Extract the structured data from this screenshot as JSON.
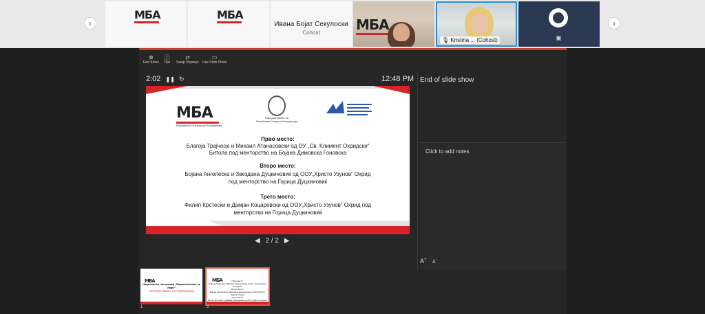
{
  "strip": {
    "tiles": [
      {
        "logo": "МБА"
      },
      {
        "logo": "МБА"
      },
      {
        "name": "Ивана Бојат Секулоски",
        "role": "Cohost"
      },
      {
        "logo": "МБА"
      },
      {
        "name": "Kristina ...",
        "role": "(Cohost)"
      },
      {
        "icon": "obs-logo-icon"
      }
    ]
  },
  "toolbar": {
    "end_show": "End Show",
    "tips": "Tips",
    "swap_displays": "Swap Displays",
    "use_slide_show": "Use Slide Show"
  },
  "presenter": {
    "timer": "2:02",
    "clock": "12:48 PM",
    "pager": "2 / 2",
    "end_of_show": "End of slide show",
    "notes_placeholder": "Click to add notes",
    "font_up": "A",
    "font_down": "A"
  },
  "slide": {
    "logo_text": "МБА",
    "logo_caption": "Македонска Банкарска Асоцијација",
    "bank_caption_1": "Народна Банка на",
    "bank_caption_2": "Република Северна Македонија",
    "first_head": "Прво место:",
    "first_1": "Благоја Трајческi и Михаил Атанасовски од ОУ „Св. Климент Охридски“",
    "first_2": "Битола под менторство на Бојана Димовска Гоновска",
    "second_head": "Второ место:",
    "second_1": "Бојана Ангелеска и Звездана Дуцкиновиќ од ООУ„Христо Узунов“ Охрид",
    "second_2": "под менторство на Горица Дуцкиновиќ",
    "third_head": "Трето место:",
    "third_1": "Филип Крстески и Дамјан Коцаревски од ООУ„Христо Узунов“ Охрид под",
    "third_2": "менторство на Горица Дуцкиновиќ"
  },
  "thumbs": [
    {
      "num": "1",
      "title": "Национален натпревар „Европска квиз на пари“",
      "sub": "ПРОГЛАСУВАЊЕ НА ПОБЕДНИЦИ"
    },
    {
      "num": "2"
    }
  ],
  "colors": {
    "accent": "#d8232a",
    "presenter_bar": "#c8402c",
    "selection": "#2b8ccf"
  }
}
